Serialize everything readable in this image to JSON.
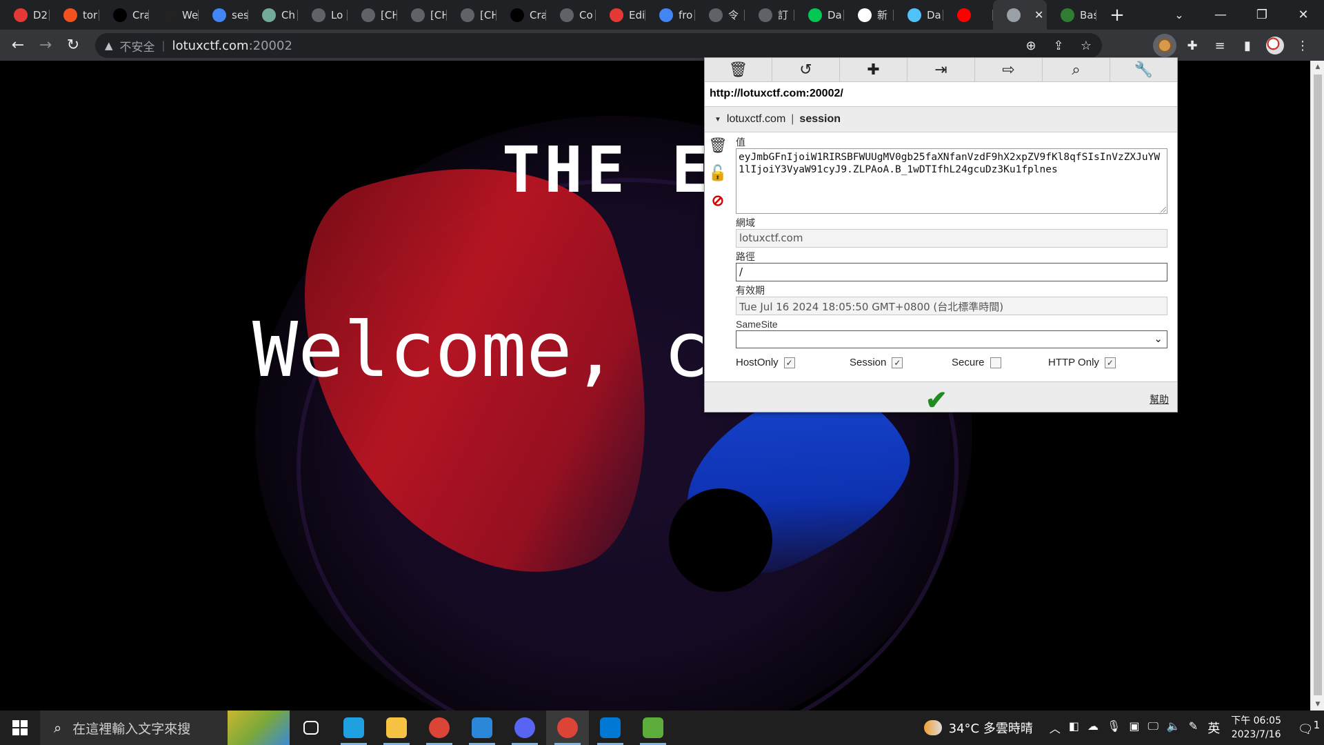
{
  "browser": {
    "tabs": [
      {
        "label": "D2",
        "icon": "red-circle-icon",
        "color": "#e53935"
      },
      {
        "label": "tor",
        "icon": "c-logo-icon",
        "color": "#f4511e"
      },
      {
        "label": "Cra",
        "icon": "eyes-icon",
        "color": "#000000"
      },
      {
        "label": "We",
        "icon": "moon-icon",
        "color": "#222222"
      },
      {
        "label": "ses",
        "icon": "google-icon",
        "color": "#4285f4"
      },
      {
        "label": "Ch",
        "icon": "openai-icon",
        "color": "#74aa9c"
      },
      {
        "label": "Lo",
        "icon": "page-icon",
        "color": "#5f6368"
      },
      {
        "label": "[CH",
        "icon": "page-icon",
        "color": "#5f6368"
      },
      {
        "label": "[CH",
        "icon": "page-icon",
        "color": "#5f6368"
      },
      {
        "label": "[CH",
        "icon": "page-icon",
        "color": "#5f6368"
      },
      {
        "label": "Cra",
        "icon": "eyes-icon",
        "color": "#000000"
      },
      {
        "label": "Co",
        "icon": "translate-icon",
        "color": "#5f6368"
      },
      {
        "label": "Edi",
        "icon": "s-logo-icon",
        "color": "#e53935"
      },
      {
        "label": "fro",
        "icon": "google-icon",
        "color": "#4285f4"
      },
      {
        "label": "令",
        "icon": "translate-icon",
        "color": "#5f6368"
      },
      {
        "label": "訂",
        "icon": "globe-icon",
        "color": "#5f6368"
      },
      {
        "label": "Da",
        "icon": "leaf-icon",
        "color": "#00c853"
      },
      {
        "label": "新",
        "icon": "chatgpt-icon",
        "color": "#ffffff"
      },
      {
        "label": "Da",
        "icon": "docs-icon",
        "color": "#4fc3f7"
      },
      {
        "label": "",
        "icon": "youtube-icon",
        "color": "#ff0000"
      },
      {
        "label": "",
        "icon": "globe-icon",
        "color": "#9aa0a6",
        "active": true
      },
      {
        "label": "Bas",
        "icon": "b64-icon",
        "color": "#2e7d32"
      }
    ],
    "address": {
      "insecure_label": "不安全",
      "host": "lotuxctf.com",
      "port": ":20002"
    }
  },
  "page": {
    "title": "THE E",
    "welcome": "Welcome, c"
  },
  "cookie_editor": {
    "url": "http://lotuxctf.com:20002/",
    "cookie_domain": "lotuxctf.com",
    "cookie_name": "session",
    "labels": {
      "value": "值",
      "domain": "網域",
      "path": "路徑",
      "expires": "有效期",
      "samesite": "SameSite",
      "hostonly": "HostOnly",
      "session": "Session",
      "secure": "Secure",
      "httponly": "HTTP Only",
      "help": "幫助"
    },
    "value": "eyJmbGFnIjoiW1RIRSBFWUUgMV0gb25faXNfanVzdF9hX2xpZV9fKl8qfSIsInVzZXJuYW1lIjoiY3VyaW91cyJ9.ZLPAoA.B_1wDTIfhL24gcuDz3Ku1fplnes",
    "domain": "lotuxctf.com",
    "path": "/",
    "expires": "Tue Jul 16 2024 18:05:50 GMT+0800 (台北標準時間)",
    "samesite": "",
    "flags": {
      "hostonly": true,
      "session": true,
      "secure": false,
      "httponly": true
    }
  },
  "taskbar": {
    "search_placeholder": "在這裡輸入文字來搜",
    "apps": [
      {
        "name": "task-view",
        "color": "#ffffff"
      },
      {
        "name": "edge",
        "color": "#1fa0e0"
      },
      {
        "name": "file-explorer",
        "color": "#f6c342"
      },
      {
        "name": "chrome",
        "color": "#db4437"
      },
      {
        "name": "mail",
        "color": "#2b88d8"
      },
      {
        "name": "discord",
        "color": "#5865f2"
      },
      {
        "name": "chrome-active",
        "color": "#db4437"
      },
      {
        "name": "vscode",
        "color": "#0078d4"
      },
      {
        "name": "minecraft",
        "color": "#5cad3c"
      }
    ],
    "weather": "34°C 多雲時晴",
    "ime": "英",
    "time": "下午 06:05",
    "date": "2023/7/16",
    "notification_count": "1"
  }
}
